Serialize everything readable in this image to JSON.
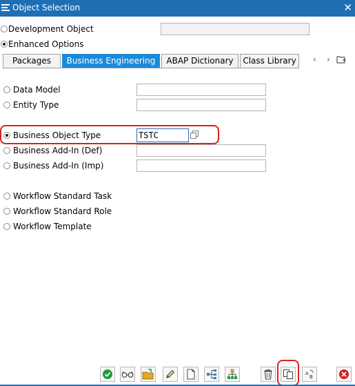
{
  "window": {
    "title": "Object Selection"
  },
  "top_options": {
    "development_object": "Development Object",
    "enhanced_options": "Enhanced Options"
  },
  "tabs": [
    {
      "label": "Packages",
      "active": false
    },
    {
      "label": "Business Engineering",
      "active": true
    },
    {
      "label": "ABAP Dictionary",
      "active": false
    },
    {
      "label": "Class Library",
      "active": false
    }
  ],
  "group1": {
    "data_model": "Data Model",
    "entity_type": "Entity Type"
  },
  "group2": {
    "business_object_type": "Business Object Type",
    "business_object_type_value": "TSTC",
    "business_addin_def": "Business Add-In (Def)",
    "business_addin_imp": "Business Add-In (Imp)"
  },
  "group3": {
    "workflow_standard_task": "Workflow Standard Task",
    "workflow_standard_role": "Workflow Standard Role",
    "workflow_template": "Workflow Template"
  },
  "colors": {
    "title_bar": "#1f6fb5",
    "active_tab": "#1c8ad9",
    "annotation": "#d82020",
    "confirm": "#1e9e3a",
    "cancel": "#d32020"
  },
  "toolbar_icons": [
    "check-icon",
    "glasses-icon",
    "folder-icon",
    "pencil-icon",
    "document-icon",
    "tree-icon",
    "hierarchy-icon",
    "trash-icon",
    "copy-icon",
    "ab-icon",
    "cancel-icon"
  ]
}
